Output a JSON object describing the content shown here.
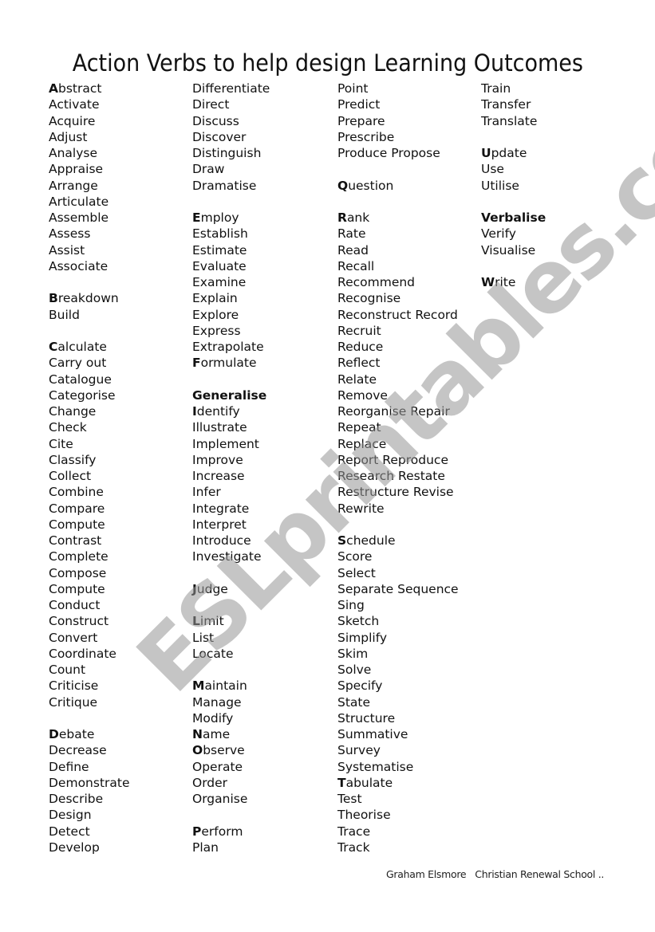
{
  "document": {
    "title": "Action Verbs to help design Learning Outcomes",
    "footer": "Graham Elsmore   Christian Renewal School ..",
    "watermark": "ESLprintables.com"
  },
  "columns": [
    {
      "rows": [
        {
          "first": "A",
          "rest": "bstract"
        },
        {
          "text": "Activate"
        },
        {
          "text": "Acquire"
        },
        {
          "text": "Adjust"
        },
        {
          "text": "Analyse"
        },
        {
          "text": "Appraise"
        },
        {
          "text": "Arrange"
        },
        {
          "text": "Articulate"
        },
        {
          "text": "Assemble"
        },
        {
          "text": "Assess"
        },
        {
          "text": "Assist"
        },
        {
          "text": "Associate"
        },
        {
          "blank": true
        },
        {
          "first": "B",
          "rest": "reakdown"
        },
        {
          "text": "Build"
        },
        {
          "blank": true
        },
        {
          "first": "C",
          "rest": "alculate"
        },
        {
          "text": "Carry out"
        },
        {
          "text": "Catalogue"
        },
        {
          "text": "Categorise"
        },
        {
          "text": "Change"
        },
        {
          "text": "Check"
        },
        {
          "text": "Cite"
        },
        {
          "text": "Classify"
        },
        {
          "text": "Collect"
        },
        {
          "text": "Combine"
        },
        {
          "text": "Compare"
        },
        {
          "text": "Compute"
        },
        {
          "text": "Contrast"
        },
        {
          "text": "Complete"
        },
        {
          "text": "Compose"
        },
        {
          "text": "Compute"
        },
        {
          "text": "Conduct"
        },
        {
          "text": "Construct"
        },
        {
          "text": "Convert"
        },
        {
          "text": "Coordinate"
        },
        {
          "text": "Count"
        },
        {
          "text": "Criticise"
        },
        {
          "text": "Critique"
        },
        {
          "blank": true
        },
        {
          "first": "D",
          "rest": "ebate"
        },
        {
          "text": "Decrease"
        },
        {
          "text": "Define"
        },
        {
          "text": "Demonstrate"
        },
        {
          "text": "Describe"
        },
        {
          "text": "Design"
        },
        {
          "text": "Detect"
        },
        {
          "text": "Develop"
        }
      ]
    },
    {
      "rows": [
        {
          "text": "Differentiate"
        },
        {
          "text": "Direct"
        },
        {
          "text": "Discuss"
        },
        {
          "text": "Discover"
        },
        {
          "text": "Distinguish"
        },
        {
          "text": "Draw"
        },
        {
          "text": "Dramatise"
        },
        {
          "blank": true
        },
        {
          "first": "E",
          "rest": "mploy"
        },
        {
          "text": "Establish"
        },
        {
          "text": "Estimate"
        },
        {
          "text": "Evaluate"
        },
        {
          "text": "Examine"
        },
        {
          "text": "Explain"
        },
        {
          "text": "Explore"
        },
        {
          "text": "Express"
        },
        {
          "text": "Extrapolate"
        },
        {
          "first": "F",
          "rest": "ormulate"
        },
        {
          "blank": true
        },
        {
          "bold": "Generalise"
        },
        {
          "first": "I",
          "rest": "dentify"
        },
        {
          "text": "Illustrate"
        },
        {
          "text": "Implement"
        },
        {
          "text": "Improve"
        },
        {
          "text": "Increase"
        },
        {
          "text": "Infer"
        },
        {
          "text": "Integrate"
        },
        {
          "text": "Interpret"
        },
        {
          "text": "Introduce"
        },
        {
          "text": "Investigate"
        },
        {
          "blank": true
        },
        {
          "first": "J",
          "rest": "udge"
        },
        {
          "blank": true
        },
        {
          "first": "L",
          "rest": "imit"
        },
        {
          "text": "List"
        },
        {
          "text": "Locate"
        },
        {
          "blank": true
        },
        {
          "first": "M",
          "rest": "aintain"
        },
        {
          "text": "Manage"
        },
        {
          "text": "Modify"
        },
        {
          "first": "N",
          "rest": "ame"
        },
        {
          "first": "O",
          "rest": "bserve"
        },
        {
          "text": "Operate"
        },
        {
          "text": "Order"
        },
        {
          "text": "Organise"
        },
        {
          "blank": true
        },
        {
          "first": "P",
          "rest": "erform"
        },
        {
          "text": "Plan"
        }
      ]
    },
    {
      "rows": [
        {
          "text": "Point"
        },
        {
          "text": "Predict"
        },
        {
          "text": "Prepare"
        },
        {
          "text": "Prescribe"
        },
        {
          "text": "Produce Propose"
        },
        {
          "blank": true
        },
        {
          "first": "Q",
          "rest": "uestion"
        },
        {
          "blank": true
        },
        {
          "first": "R",
          "rest": "ank"
        },
        {
          "text": "Rate"
        },
        {
          "text": "Read"
        },
        {
          "text": "Recall"
        },
        {
          "text": "Recommend"
        },
        {
          "text": "Recognise"
        },
        {
          "text": "Reconstruct Record"
        },
        {
          "text": "Recruit"
        },
        {
          "text": "Reduce"
        },
        {
          "text": "Reflect"
        },
        {
          "text": "Relate"
        },
        {
          "text": "Remove"
        },
        {
          "text": "Reorganise Repair"
        },
        {
          "text": "Repeat"
        },
        {
          "text": "Replace"
        },
        {
          "text": "Report Reproduce"
        },
        {
          "text": "Research Restate"
        },
        {
          "text": "Restructure Revise"
        },
        {
          "text": "Rewrite"
        },
        {
          "blank": true
        },
        {
          "first": "S",
          "rest": "chedule"
        },
        {
          "text": "Score"
        },
        {
          "text": "Select"
        },
        {
          "text": "Separate Sequence"
        },
        {
          "text": "Sing"
        },
        {
          "text": "Sketch"
        },
        {
          "text": "Simplify"
        },
        {
          "text": "Skim"
        },
        {
          "text": "Solve"
        },
        {
          "text": "Specify"
        },
        {
          "text": "State"
        },
        {
          "text": "Structure"
        },
        {
          "text": "Summative"
        },
        {
          "text": "Survey"
        },
        {
          "text": "Systematise"
        },
        {
          "first": "T",
          "rest": "abulate"
        },
        {
          "text": "Test"
        },
        {
          "text": "Theorise"
        },
        {
          "text": "Trace"
        },
        {
          "text": "Track"
        }
      ]
    },
    {
      "rows": [
        {
          "text": "Train"
        },
        {
          "text": "Transfer"
        },
        {
          "text": "Translate"
        },
        {
          "blank": true
        },
        {
          "first": "U",
          "rest": "pdate"
        },
        {
          "text": "Use"
        },
        {
          "text": "Utilise"
        },
        {
          "blank": true
        },
        {
          "bold": "Verbalise"
        },
        {
          "text": "Verify"
        },
        {
          "text": "Visualise"
        },
        {
          "blank": true
        },
        {
          "first": "W",
          "rest": "rite"
        }
      ]
    }
  ]
}
